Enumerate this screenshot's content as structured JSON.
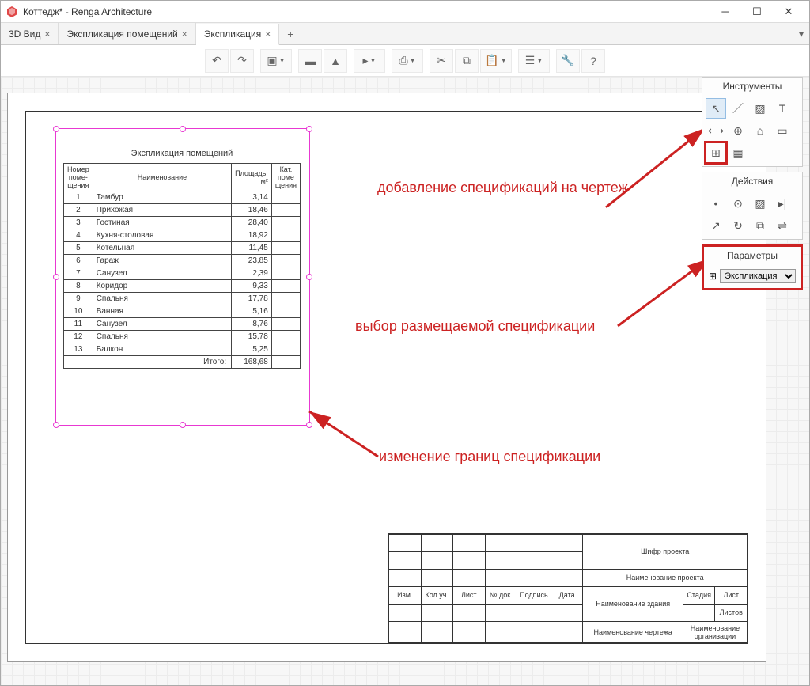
{
  "window": {
    "title": "Коттедж* - Renga Architecture"
  },
  "tabs": {
    "items": [
      {
        "label": "3D Вид",
        "closable": true
      },
      {
        "label": "Экспликация помещений",
        "closable": true
      },
      {
        "label": "Экспликация",
        "closable": true,
        "active": true
      }
    ],
    "new_tab": "+"
  },
  "spec_table": {
    "title": "Экспликация помещений",
    "headers": {
      "num": "Номер поме-щения",
      "name": "Наименование",
      "area": "Площадь, м²",
      "cat": "Кат. поме щения"
    },
    "rows": [
      {
        "n": "1",
        "name": "Тамбур",
        "area": "3,14"
      },
      {
        "n": "2",
        "name": "Прихожая",
        "area": "18,46"
      },
      {
        "n": "3",
        "name": "Гостиная",
        "area": "28,40"
      },
      {
        "n": "4",
        "name": "Кухня-столовая",
        "area": "18,92"
      },
      {
        "n": "5",
        "name": "Котельная",
        "area": "11,45"
      },
      {
        "n": "6",
        "name": "Гараж",
        "area": "23,85"
      },
      {
        "n": "7",
        "name": "Санузел",
        "area": "2,39"
      },
      {
        "n": "8",
        "name": "Коридор",
        "area": "9,33"
      },
      {
        "n": "9",
        "name": "Спальня",
        "area": "17,78"
      },
      {
        "n": "10",
        "name": "Ванная",
        "area": "5,16"
      },
      {
        "n": "11",
        "name": "Санузел",
        "area": "8,76"
      },
      {
        "n": "12",
        "name": "Спальня",
        "area": "15,78"
      },
      {
        "n": "13",
        "name": "Балкон",
        "area": "5,25"
      }
    ],
    "total_label": "Итого:",
    "total_value": "168,68"
  },
  "titleblock": {
    "project_code": "Шифр проекта",
    "project_name": "Наименование проекта",
    "stage": "Стадия",
    "sheet": "Лист",
    "sheets": "Листов",
    "building": "Наименование здания",
    "drawing": "Наименование чертежа",
    "org": "Наименование организации",
    "cols": [
      "Изм.",
      "Кол.уч.",
      "Лист",
      "№ док.",
      "Подпись",
      "Дата"
    ]
  },
  "panels": {
    "tools": {
      "title": "Инструменты"
    },
    "actions": {
      "title": "Действия"
    },
    "params": {
      "title": "Параметры",
      "dropdown": "Экспликация"
    }
  },
  "annotations": {
    "a1": "добавление спецификаций на чертеж",
    "a2": "выбор размещаемой спецификации",
    "a3": "изменение границ спецификации"
  }
}
